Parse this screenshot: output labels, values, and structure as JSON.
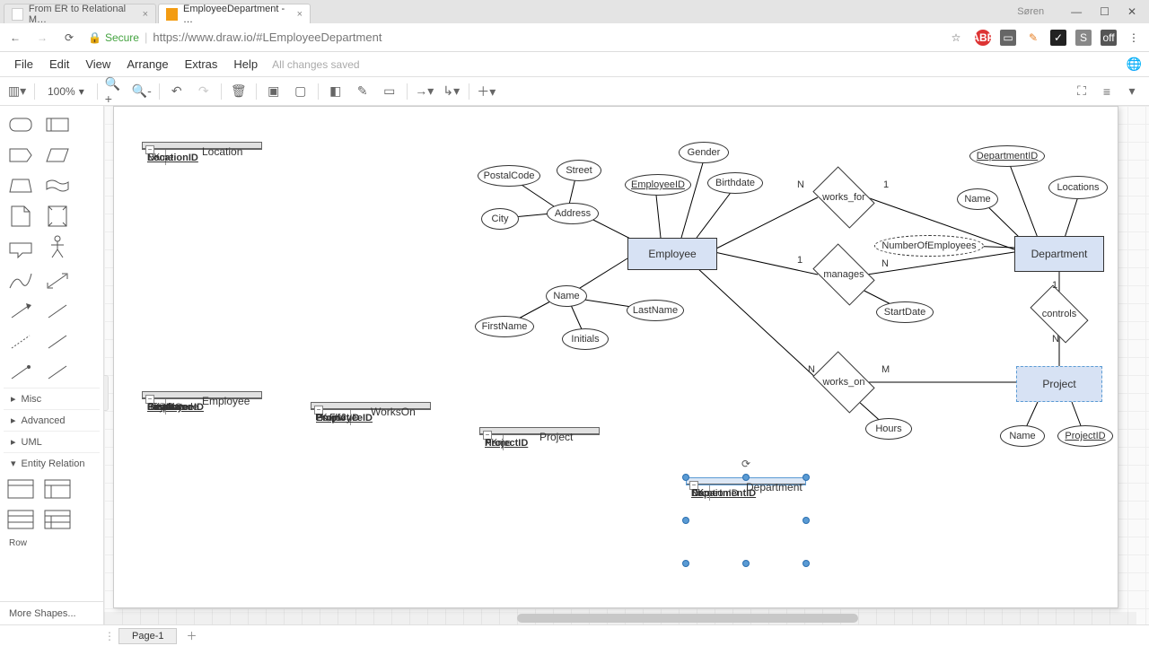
{
  "browser": {
    "tabs": [
      {
        "title": "From ER to Relational M…"
      },
      {
        "title": "EmployeeDepartment - …"
      }
    ],
    "user": "Søren",
    "secure_label": "Secure",
    "url": "https://www.draw.io/#LEmployeeDepartment"
  },
  "menu": {
    "items": [
      "File",
      "Edit",
      "View",
      "Arrange",
      "Extras",
      "Help"
    ],
    "status": "All changes saved"
  },
  "toolbar": {
    "zoom": "100%"
  },
  "sidebar": {
    "groups": [
      "Misc",
      "Advanced",
      "UML",
      "Entity Relation"
    ],
    "row_label": "Row",
    "more": "More Shapes..."
  },
  "pages": {
    "tab": "Page-1"
  },
  "er": {
    "entities": {
      "employee": "Employee",
      "department": "Department",
      "project": "Project"
    },
    "attrs": {
      "postalcode": "PostalCode",
      "street": "Street",
      "city": "City",
      "address": "Address",
      "employeeid": "EmployeeID",
      "gender": "Gender",
      "birthdate": "Birthdate",
      "name1": "Name",
      "firstname": "FirstName",
      "initials": "Initials",
      "lastname": "LastName",
      "departmentid": "DepartmentID",
      "locations": "Locations",
      "name2": "Name",
      "numemp": "NumberOfEmployees",
      "startdate": "StartDate",
      "hours": "Hours",
      "name3": "Name",
      "projectid": "ProjectID"
    },
    "rels": {
      "worksfor": "works_for",
      "manages": "manages",
      "workson": "works_on",
      "controls": "controls"
    },
    "card": {
      "n": "N",
      "one": "1",
      "m": "M"
    }
  },
  "tables": {
    "location": {
      "title": "Location",
      "rows": [
        {
          "k": "PK",
          "v": "LocationID",
          "pk": true
        },
        {
          "k": "",
          "v": "Name"
        }
      ]
    },
    "employee": {
      "title": "Employee",
      "rows": [
        {
          "k": "PK",
          "v": "EmployeeID",
          "pk": true
        },
        {
          "k": "",
          "v": "Gender"
        },
        {
          "k": "",
          "v": "BirthDate"
        },
        {
          "k": "",
          "v": "Street"
        },
        {
          "k": "",
          "v": "PostalCode"
        },
        {
          "k": "",
          "v": "City"
        },
        {
          "k": "",
          "v": "FirstName"
        },
        {
          "k": "",
          "v": "Initials"
        },
        {
          "k": "",
          "v": "LastName"
        }
      ]
    },
    "workson": {
      "title": "WorksOn",
      "rows": [
        {
          "k": "PK,FK1",
          "v": "EmployeeID",
          "pk": true
        },
        {
          "k": "PK,FK2",
          "v": "ProjectID",
          "pk": true
        },
        {
          "k": "",
          "v": "Hours"
        }
      ]
    },
    "project": {
      "title": "Project",
      "rows": [
        {
          "k": "PK",
          "v": "ProjectID",
          "pk": true
        },
        {
          "k": "",
          "v": "Name"
        }
      ]
    },
    "department": {
      "title": "Department",
      "rows": [
        {
          "k": "PK",
          "v": "DepartmentID",
          "pk": true
        },
        {
          "k": "",
          "v": "Name"
        },
        {
          "k": "FK",
          "v": "LocationID"
        }
      ]
    }
  }
}
